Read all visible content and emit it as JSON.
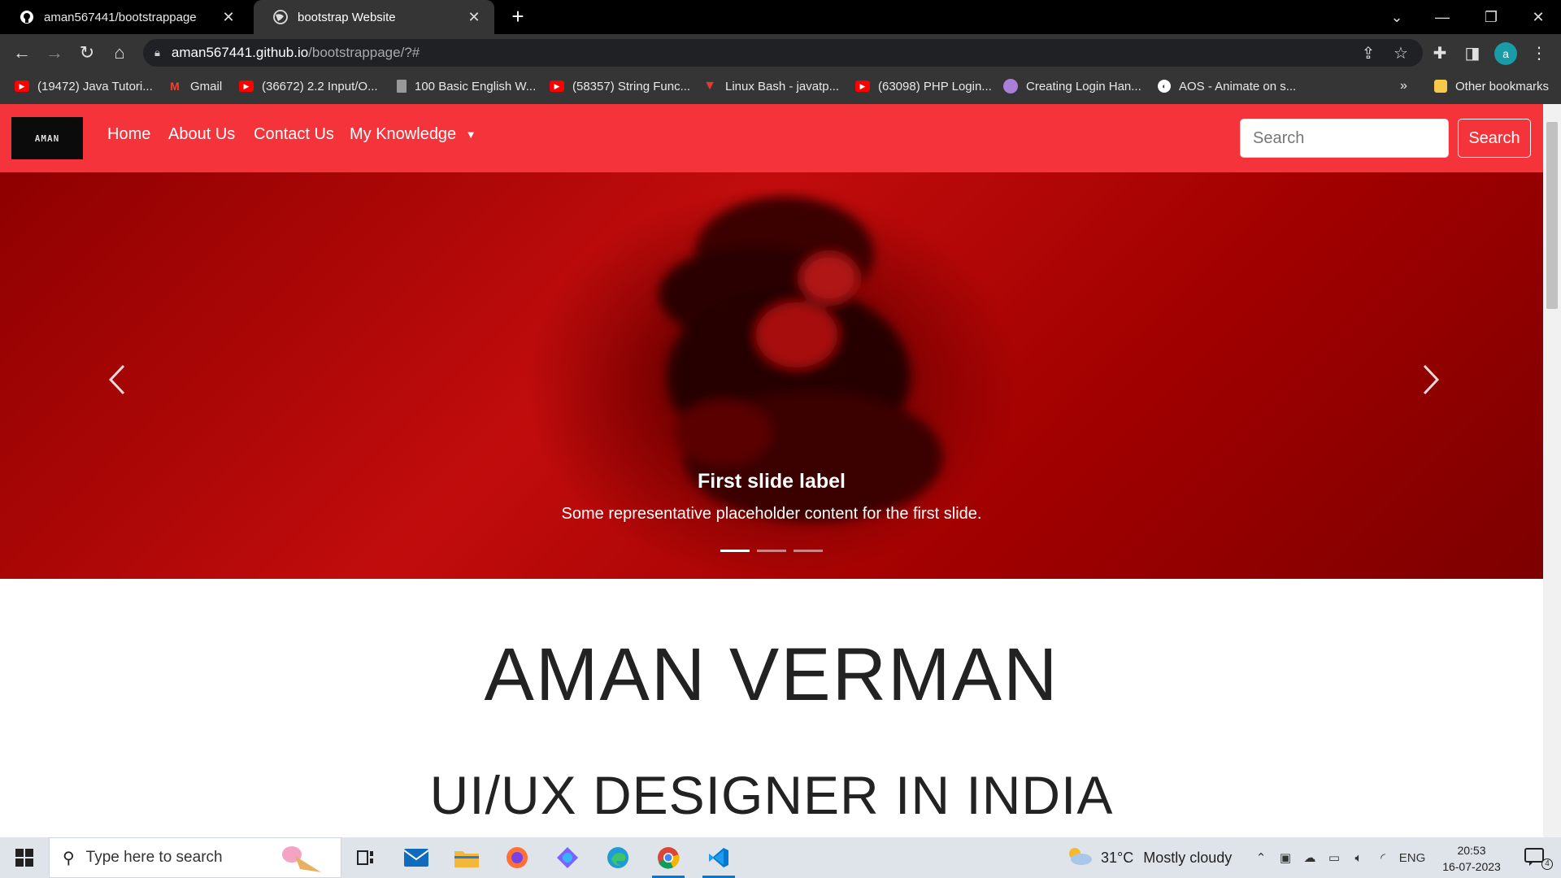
{
  "browser": {
    "tabs": [
      {
        "title": "aman567441/bootstrappage",
        "active": false,
        "icon": "github-icon"
      },
      {
        "title": "bootstrap Website",
        "active": true,
        "icon": "globe-icon"
      }
    ],
    "url_host": "aman567441.github.io",
    "url_path": "/bootstrappage/?#",
    "profile_initial": "a",
    "bookmarks": [
      {
        "label": "(19472) Java Tutori...",
        "icon": "youtube-icon"
      },
      {
        "label": "Gmail",
        "icon": "gmail-icon"
      },
      {
        "label": "(36672) 2.2 Input/O...",
        "icon": "youtube-icon"
      },
      {
        "label": "100 Basic English W...",
        "icon": "document-icon"
      },
      {
        "label": "(58357) String Func...",
        "icon": "youtube-icon"
      },
      {
        "label": "Linux Bash - javatp...",
        "icon": "javatpoint-icon"
      },
      {
        "label": "(63098) PHP Login...",
        "icon": "youtube-icon"
      },
      {
        "label": "Creating Login Han...",
        "icon": "avatar-icon"
      },
      {
        "label": "AOS - Animate on s...",
        "icon": "globe-icon"
      }
    ],
    "bookmarks_overflow": "»",
    "other_bookmarks": "Other bookmarks"
  },
  "site": {
    "logo_text": "AMAN",
    "nav": {
      "home": "Home",
      "about": "About Us",
      "contact": "Contact Us",
      "knowledge": "My Knowledge"
    },
    "search_placeholder": "Search",
    "search_button": "Search",
    "carousel": {
      "caption_title": "First slide label",
      "caption_text": "Some representative placeholder content for the first slide.",
      "slide_count": 3,
      "active_slide": 1
    },
    "hero_name": "AMAN VERMAN",
    "hero_role": "UI/UX DESIGNER IN INDIA"
  },
  "taskbar": {
    "search_placeholder": "Type here to search",
    "weather_temp": "31°C",
    "weather_desc": "Mostly cloudy",
    "language": "ENG",
    "time": "20:53",
    "date": "16-07-2023",
    "notification_count": "4",
    "colors": {
      "accent": "#0078d4",
      "site_red": "#f4333a"
    }
  }
}
